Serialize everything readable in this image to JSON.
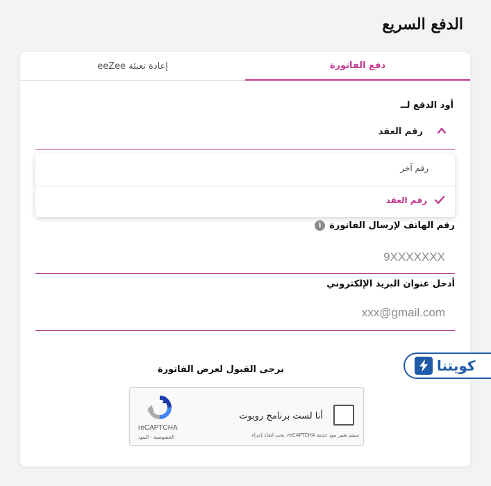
{
  "page": {
    "title": "الدفع السريع"
  },
  "tabs": [
    {
      "label": "دفع الفاتورة",
      "active": true
    },
    {
      "label": "إعادة تعبئة eeZee",
      "active": false
    }
  ],
  "pay_for": {
    "label": "أود الدفع لــ",
    "selected": "رقم العقد",
    "options": [
      {
        "label": "رقم آخر",
        "selected": false
      },
      {
        "label": "رقم العقد",
        "selected": true
      }
    ]
  },
  "phone_field": {
    "label": "رقم الهاتف لإرسال الفاتورة",
    "placeholder": "9XXXXXXX",
    "info_icon": "i"
  },
  "email_field": {
    "label": "أدخل عنوان البريد الإلكتروني",
    "placeholder": "xxx@gmail.com"
  },
  "accept": {
    "label": "يرجى القبول لعرض الفاتورة"
  },
  "recaptcha": {
    "checkbox_label": "أنا لست برنامج روبوت",
    "brand": "reCAPTCHA",
    "links": "الخصوصية - البنود",
    "terms": "سيتم تغيير بنود خدمة reCAPTCHA. يجب اتخاذ إجراء."
  },
  "badge": {
    "text": "كويتنا"
  },
  "colors": {
    "accent": "#c3388f",
    "badge_blue": "#1f5ba8"
  }
}
